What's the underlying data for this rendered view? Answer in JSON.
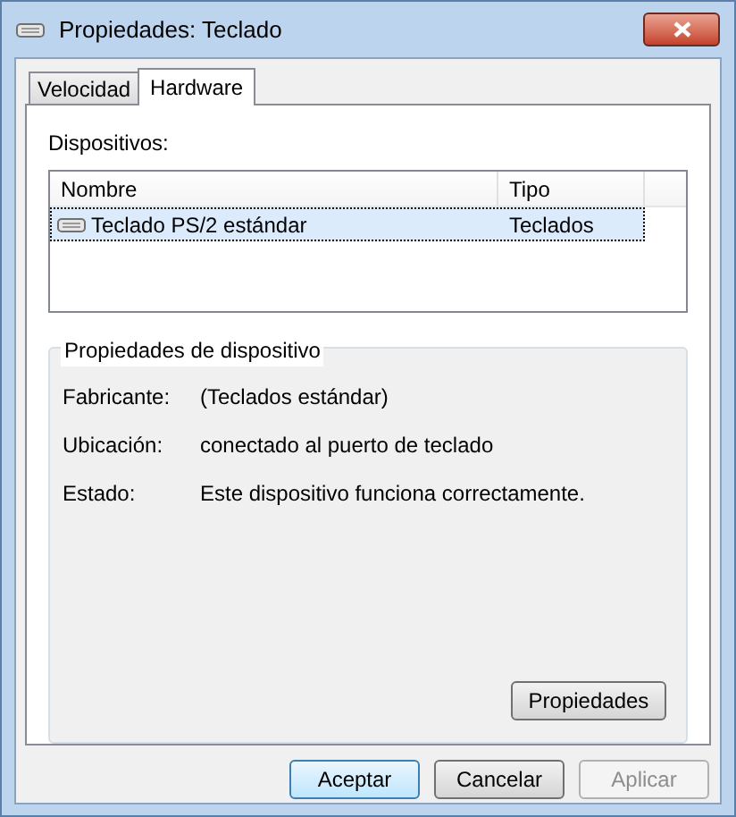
{
  "window": {
    "title": "Propiedades: Teclado"
  },
  "tabs": [
    {
      "label": "Velocidad",
      "selected": false
    },
    {
      "label": "Hardware",
      "selected": true
    }
  ],
  "devices": {
    "label": "Dispositivos:",
    "columns": [
      "Nombre",
      "Tipo"
    ],
    "rows": [
      {
        "name": "Teclado PS/2 estándar",
        "type": "Teclados",
        "selected": true
      }
    ]
  },
  "device_properties": {
    "title": "Propiedades de dispositivo",
    "fields": [
      {
        "label": "Fabricante:",
        "value": "(Teclados estándar)"
      },
      {
        "label": "Ubicación:",
        "value": "conectado al puerto de teclado"
      },
      {
        "label": "Estado:",
        "value": "Este dispositivo funciona correctamente."
      }
    ],
    "button": "Propiedades"
  },
  "buttons": [
    {
      "label": "Aceptar",
      "default": true,
      "disabled": false
    },
    {
      "label": "Cancelar",
      "default": false,
      "disabled": false
    },
    {
      "label": "Aplicar",
      "default": false,
      "disabled": true
    }
  ]
}
